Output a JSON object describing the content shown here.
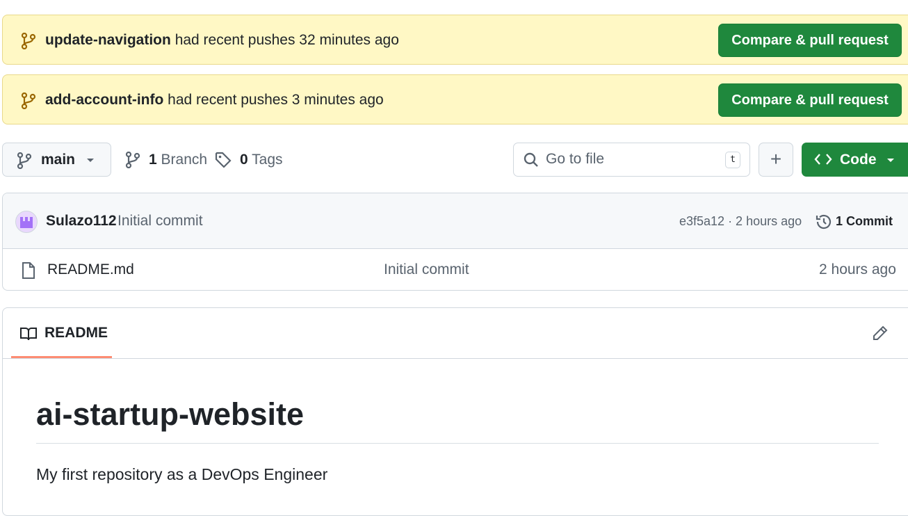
{
  "banners": [
    {
      "branch": "update-navigation",
      "message": "had recent pushes 32 minutes ago",
      "button": "Compare & pull request"
    },
    {
      "branch": "add-account-info",
      "message": "had recent pushes 3 minutes ago",
      "button": "Compare & pull request"
    }
  ],
  "toolbar": {
    "branch_selector": "main",
    "branches_count": "1",
    "branches_label": "Branch",
    "tags_count": "0",
    "tags_label": "Tags",
    "search_placeholder": "Go to file",
    "search_shortcut": "t",
    "add_label": "+",
    "code_label": "Code"
  },
  "latest_commit": {
    "author": "Sulazo112",
    "message": "Initial commit",
    "hash_time": "e3f5a12 · 2 hours ago",
    "commits_count": "1 Commit"
  },
  "files": [
    {
      "name": "README.md",
      "message": "Initial commit",
      "time": "2 hours ago"
    }
  ],
  "readme": {
    "tab_label": "README",
    "heading": "ai-startup-website",
    "body": "My first repository as a DevOps Engineer"
  },
  "colors": {
    "banner_bg": "#fff8c5",
    "green_button": "#1f883d",
    "tab_underline": "#fd8c73",
    "branch_icon": "#9a6700"
  }
}
